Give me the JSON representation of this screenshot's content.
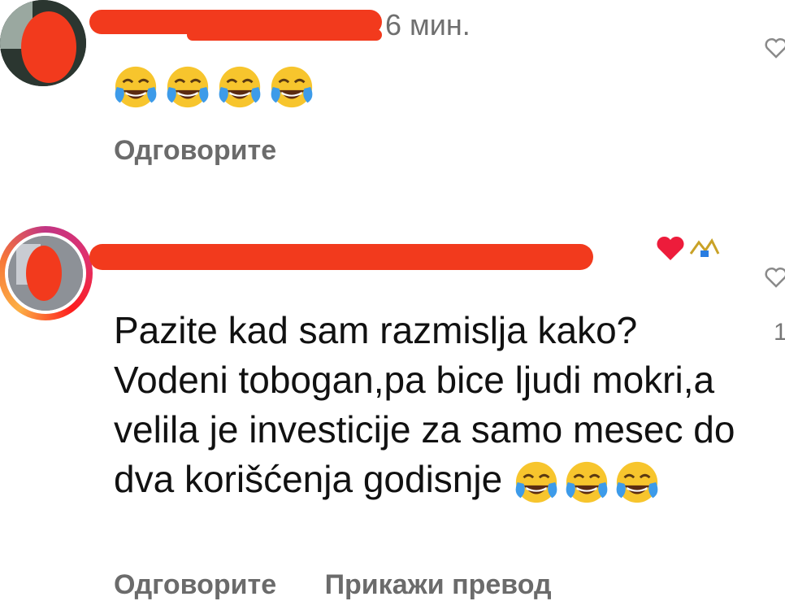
{
  "comment1": {
    "time": "6 мин.",
    "reply_label": "Одговорите",
    "emoji": [
      "😂",
      "😂",
      "😂",
      "😂"
    ]
  },
  "comment2": {
    "text": "Pazite kad sam razmislja kako?Vodeni tobogan,pa bice ljudi mokri,a velila je investicije za samo mesec do dva korišćenja godisnje",
    "like_count": "1",
    "emoji": [
      "😂",
      "😂",
      "😂"
    ]
  },
  "footer": {
    "reply_label": "Одговорите",
    "view_translation": "Прикажи превод"
  },
  "icons": {
    "like": "heart-outline-icon",
    "creator_heart": "heart-filled-icon",
    "badge": "badge-icon"
  },
  "colors": {
    "redaction": "#f23a1d",
    "heart": "#ed1c3b",
    "secondary_text": "#6b6b6b"
  }
}
